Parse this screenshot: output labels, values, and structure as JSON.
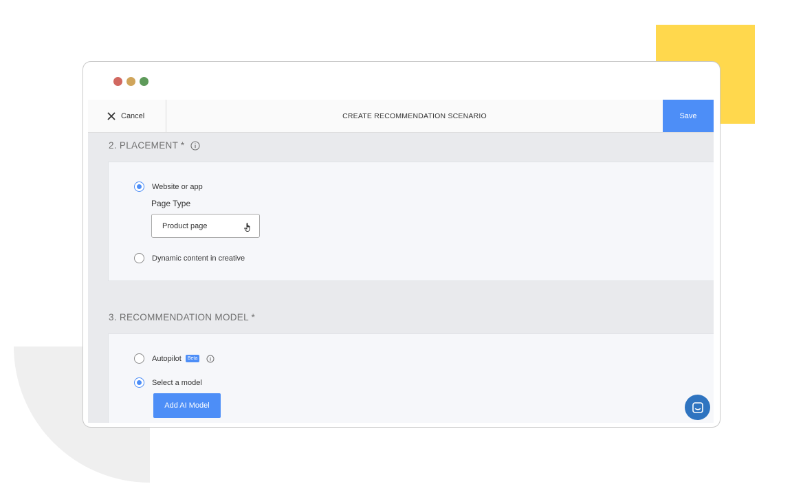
{
  "header": {
    "cancel_label": "Cancel",
    "title": "CREATE RECOMMENDATION SCENARIO",
    "save_label": "Save"
  },
  "placement": {
    "title": "2. PLACEMENT *",
    "option_website": "Website or app",
    "page_type_label": "Page Type",
    "page_type_value": "Product page",
    "option_dynamic": "Dynamic content in creative"
  },
  "model": {
    "title": "3. RECOMMENDATION MODEL *",
    "option_autopilot": "Autopilot",
    "beta_badge": "Beta",
    "option_select": "Select a model",
    "add_button": "Add AI Model"
  },
  "colors": {
    "accent": "#4d8ef7",
    "deco_yellow": "#ffd84d",
    "chat_button": "#2f74c0"
  },
  "icons": {
    "cancel": "close-icon",
    "info": "info-icon",
    "chat": "chat-icon",
    "cursor": "hand-cursor-icon"
  }
}
